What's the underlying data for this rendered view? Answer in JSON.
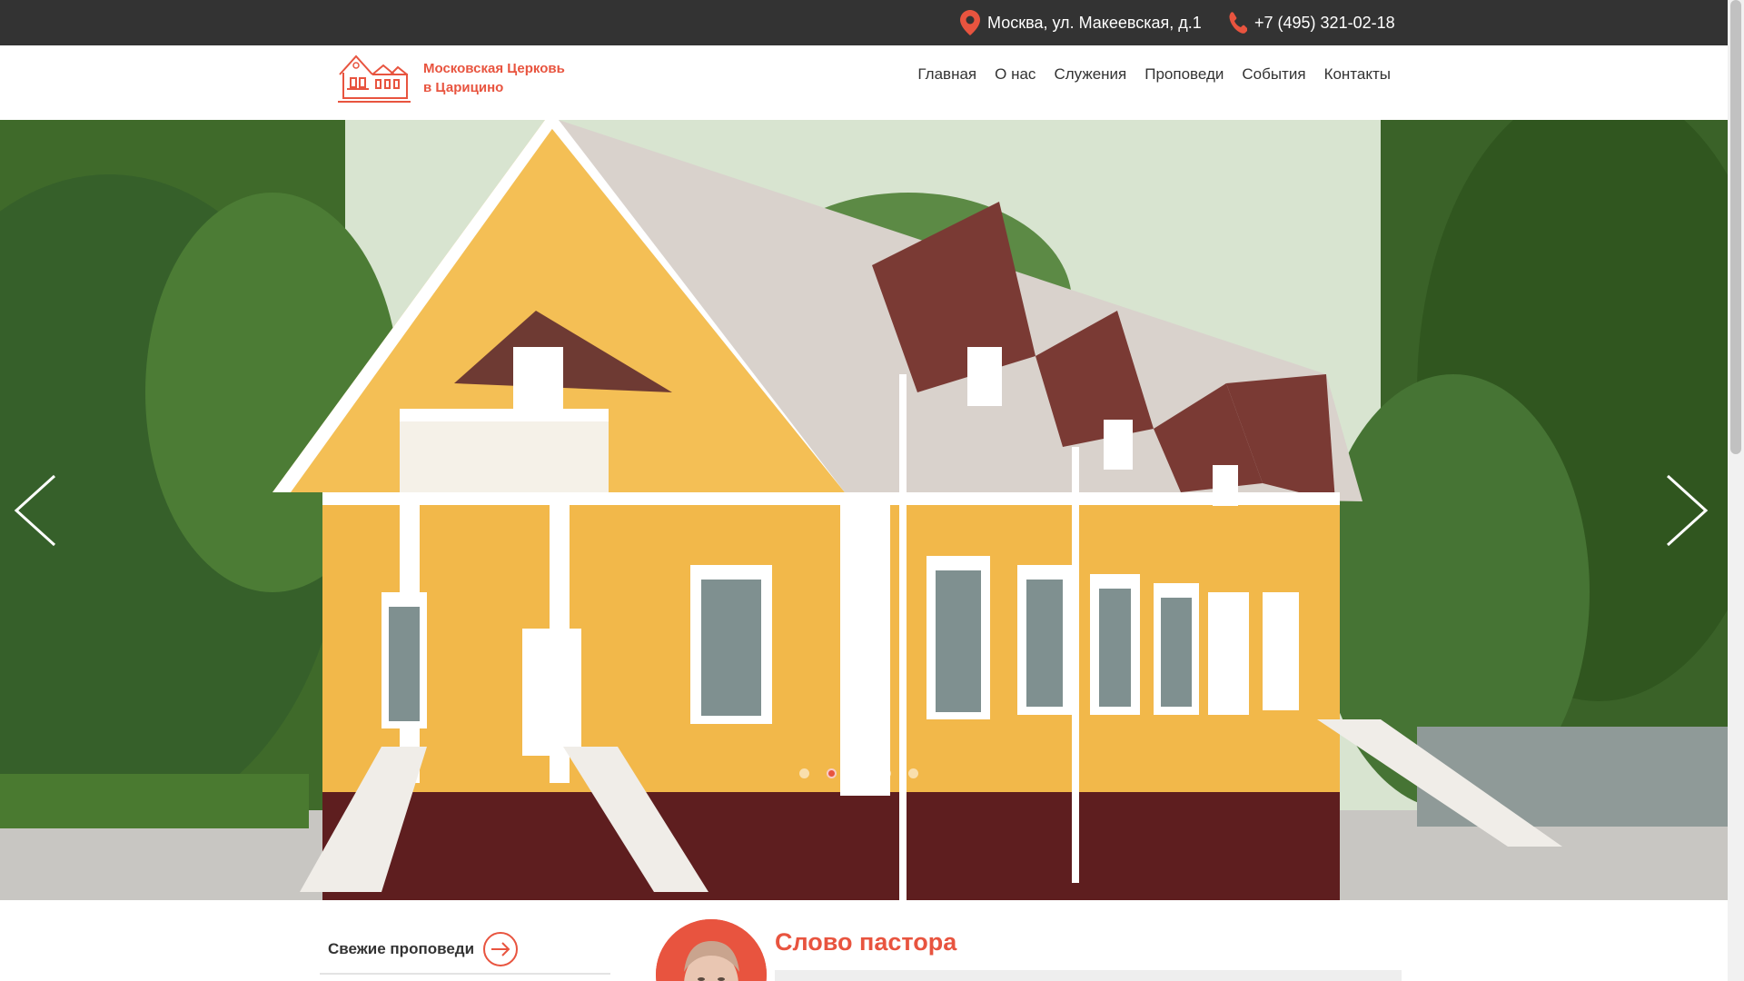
{
  "topbar": {
    "address": "Москва, ул. Макеевская, д.1",
    "phone": "+7 (495) 321-02-18",
    "background": "#333333"
  },
  "logo": {
    "line1": "Московская Церковь",
    "line2": "в Царицино",
    "color": "#e8543f"
  },
  "nav": {
    "items": [
      "Главная",
      "О нас",
      "Служения",
      "Проповеди",
      "События",
      "Контакты"
    ]
  },
  "slider": {
    "slide_count": 5,
    "active_slide": 2,
    "image": "church-building-photo"
  },
  "sermons": {
    "label": "Свежие проповеди"
  },
  "pastor": {
    "title": "Слово пастора"
  },
  "colors": {
    "accent": "#e8543f"
  }
}
